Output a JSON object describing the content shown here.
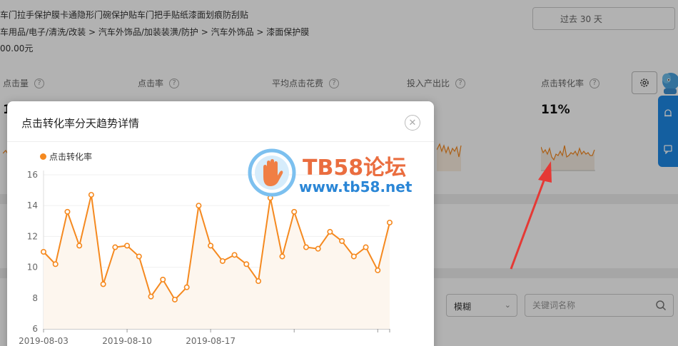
{
  "header": {
    "product_title": "车门拉手保护膜卡通隐形门碗保护贴车门把手贴纸漆面划痕防刮贴",
    "breadcrumb": "车用品/电子/清洗/改装 > 汽车外饰品/加装装潢/防护 > 汽车外饰品 > 漆面保护膜",
    "price": "00.00元",
    "date_range": "过去 30 天"
  },
  "metrics": {
    "items": [
      {
        "label": "点击量"
      },
      {
        "label": "点击率"
      },
      {
        "label": "平均点击花费"
      },
      {
        "label": "投入产出比"
      },
      {
        "label": "点击转化率"
      }
    ],
    "first_value_partial": "1",
    "conversion_value": "11%",
    "help_glyph": "?"
  },
  "filters": {
    "match_type": "模糊",
    "keyword_placeholder": "关键词名称"
  },
  "modal": {
    "title": "点击转化率分天趋势详情",
    "close_glyph": "✕"
  },
  "colors": {
    "accent": "#f5891f",
    "area_fill": "#fdf6ee",
    "brand_blue": "#1e88e5",
    "arrow_red": "#e53935"
  },
  "watermark": {
    "line1": "TB58论坛",
    "line2": "www.tb58.net"
  },
  "chart_data": {
    "type": "line",
    "title": "",
    "xlabel": "",
    "ylabel": "",
    "ylim": [
      6,
      16
    ],
    "yticks": [
      6,
      8,
      10,
      12,
      14,
      16
    ],
    "x_tick_labels": [
      "2019-08-03",
      "2019-08-10",
      "2019-08-17"
    ],
    "x_tick_index": [
      0,
      7,
      14
    ],
    "grid": true,
    "legend_position": "top-left",
    "series": [
      {
        "name": "点击转化率",
        "values": [
          11.0,
          10.2,
          13.6,
          11.4,
          14.7,
          8.9,
          11.3,
          11.4,
          10.7,
          8.1,
          9.2,
          7.9,
          8.7,
          14.0,
          11.4,
          10.4,
          10.8,
          10.2,
          9.1,
          14.5,
          10.7,
          13.6,
          11.3,
          11.2,
          12.3,
          11.7,
          10.7,
          11.3,
          9.8,
          12.9
        ]
      }
    ]
  }
}
